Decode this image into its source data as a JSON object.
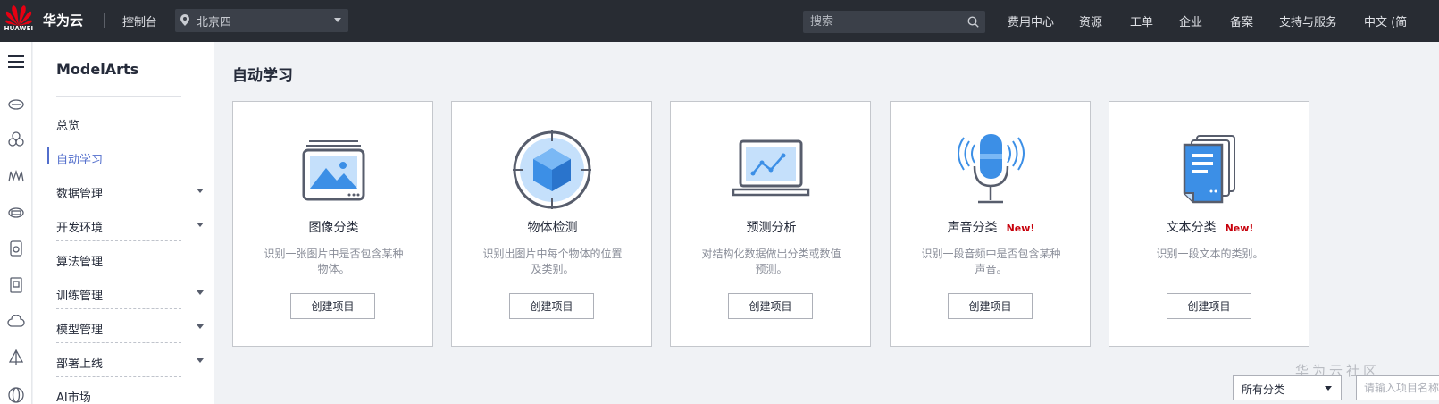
{
  "topbar": {
    "logo_text": "HUAWEI",
    "brand": "华为云",
    "console": "控制台",
    "region": "北京四",
    "search_placeholder": "搜索",
    "links": [
      "费用中心",
      "资源",
      "工单",
      "企业",
      "备案",
      "支持与服务",
      "中文 (简"
    ]
  },
  "rail": {
    "icons": [
      "menu-icon",
      "cloud-server-icon",
      "cluster-icon",
      "ai-icon",
      "database-icon",
      "storage-icon",
      "disk-icon",
      "cloud-icon",
      "sail-icon",
      "globe-icon"
    ]
  },
  "sidebar": {
    "title": "ModelArts",
    "items": [
      {
        "label": "总览",
        "expandable": false
      },
      {
        "label": "自动学习",
        "expandable": false,
        "active": true
      },
      {
        "label": "数据管理",
        "expandable": true
      },
      {
        "label": "开发环境",
        "expandable": true
      },
      {
        "label": "算法管理",
        "expandable": false
      },
      {
        "label": "训练管理",
        "expandable": true
      },
      {
        "label": "模型管理",
        "expandable": true
      },
      {
        "label": "部署上线",
        "expandable": true
      },
      {
        "label": "AI市场",
        "expandable": false
      }
    ]
  },
  "main": {
    "title": "自动学习",
    "cards": [
      {
        "title": "图像分类",
        "new_tag": "",
        "desc": "识别一张图片中是否包含某种物体。",
        "button": "创建项目",
        "icon": "image-classification-icon"
      },
      {
        "title": "物体检测",
        "new_tag": "",
        "desc": "识别出图片中每个物体的位置及类别。",
        "button": "创建项目",
        "icon": "object-detection-icon"
      },
      {
        "title": "预测分析",
        "new_tag": "",
        "desc": "对结构化数据做出分类或数值预测。",
        "button": "创建项目",
        "icon": "predictive-analysis-icon"
      },
      {
        "title": "声音分类",
        "new_tag": "New!",
        "desc": "识别一段音频中是否包含某种声音。",
        "button": "创建项目",
        "icon": "sound-classification-icon"
      },
      {
        "title": "文本分类",
        "new_tag": "New!",
        "desc": "识别一段文本的类别。",
        "button": "创建项目",
        "icon": "text-classification-icon"
      }
    ],
    "filter_label": "所有分类",
    "search_placeholder": "请输入项目名称"
  },
  "watermark": "华为云社区",
  "colors": {
    "topbar_bg": "#282c33",
    "accent": "#526ecc",
    "new_tag": "#c7000b",
    "icon_blue": "#3c8fe6"
  }
}
